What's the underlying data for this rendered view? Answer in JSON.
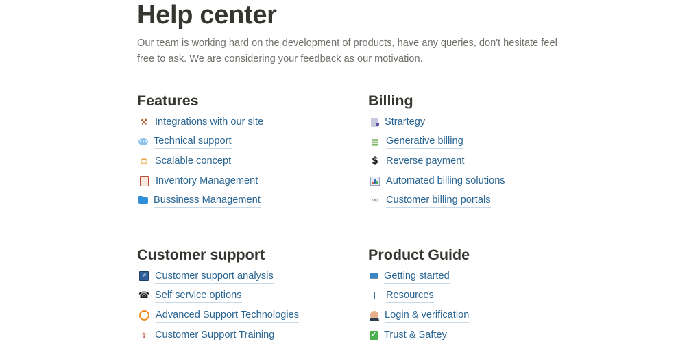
{
  "header": {
    "title": "Help center",
    "intro": "Our team is working hard on the development of products, have any queries, don't hesitate feel free to ask. We are considering your feedback as our motivation."
  },
  "sections": {
    "features": {
      "title": "Features",
      "items": [
        {
          "label": "Integrations with our site",
          "icon": "tools-icon"
        },
        {
          "label": "Technical support",
          "icon": "speech-bubble-icon"
        },
        {
          "label": "Scalable concept",
          "icon": "scale-icon"
        },
        {
          "label": "Inventory Management",
          "icon": "clipboard-icon"
        },
        {
          "label": "Bussiness Management",
          "icon": "folder-icon"
        }
      ]
    },
    "billing": {
      "title": "Billing",
      "items": [
        {
          "label": "Strartegy",
          "icon": "document-icon"
        },
        {
          "label": "Generative billing",
          "icon": "money-icon"
        },
        {
          "label": "Reverse payment",
          "icon": "dollar-icon"
        },
        {
          "label": "Automated billing solutions",
          "icon": "bar-chart-icon"
        },
        {
          "label": "Customer billing portals",
          "icon": "link-icon"
        }
      ]
    },
    "support": {
      "title": "Customer support",
      "items": [
        {
          "label": "Customer support analysis",
          "icon": "chart-icon"
        },
        {
          "label": "Self service options",
          "icon": "phone-icon"
        },
        {
          "label": "Advanced Support Technologies",
          "icon": "compass-icon"
        },
        {
          "label": "Customer Support Training",
          "icon": "weightlifter-icon"
        }
      ]
    },
    "guide": {
      "title": "Product Guide",
      "items": [
        {
          "label": "Getting started",
          "icon": "laptop-icon"
        },
        {
          "label": "Resources",
          "icon": "book-icon"
        },
        {
          "label": "Login & verification",
          "icon": "person-icon"
        },
        {
          "label": "Trust & Saftey",
          "icon": "checkmark-icon"
        }
      ]
    }
  },
  "colors": {
    "text": "#37352f",
    "muted": "#72706b",
    "link": "#2b6693"
  }
}
